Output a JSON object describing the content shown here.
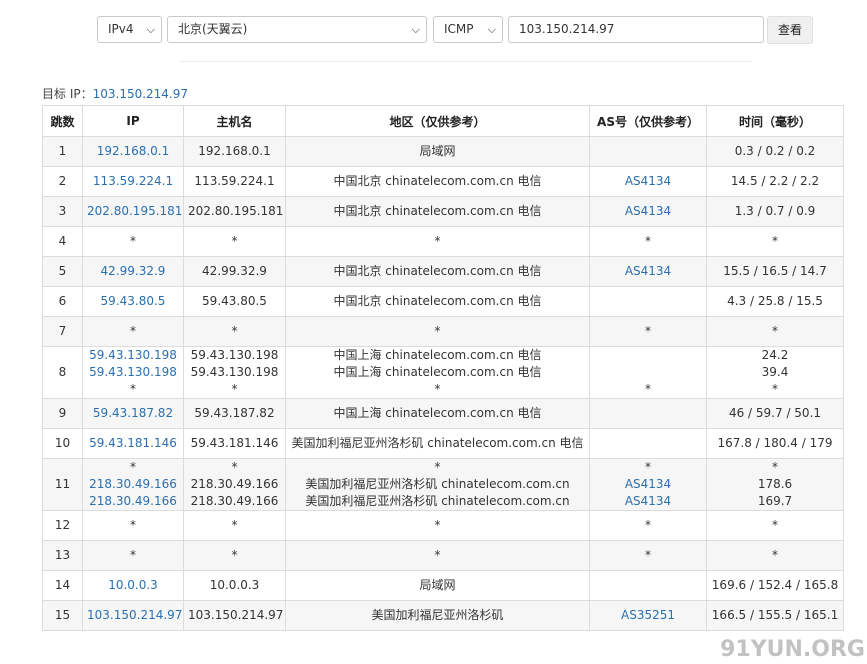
{
  "controls": {
    "ip_version": "IPv4",
    "node": "北京(天翼云)",
    "protocol": "ICMP",
    "target_input": "103.150.214.97",
    "submit_label": "查看"
  },
  "target": {
    "label": "目标 IP：",
    "value": "103.150.214.97"
  },
  "table": {
    "headers": [
      "跳数",
      "IP",
      "主机名",
      "地区（仅供参考）",
      "AS号（仅供参考）",
      "时间（毫秒）"
    ],
    "rows": [
      {
        "hop": "1",
        "ip": [
          "192.168.0.1"
        ],
        "host": [
          "192.168.0.1"
        ],
        "region": [
          "局域网"
        ],
        "asn": [
          ""
        ],
        "time": [
          "0.3 / 0.2 / 0.2"
        ]
      },
      {
        "hop": "2",
        "ip": [
          "113.59.224.1"
        ],
        "host": [
          "113.59.224.1"
        ],
        "region": [
          "中国北京 chinatelecom.com.cn 电信"
        ],
        "asn": [
          "AS4134"
        ],
        "time": [
          "14.5 / 2.2 / 2.2"
        ]
      },
      {
        "hop": "3",
        "ip": [
          "202.80.195.181"
        ],
        "host": [
          "202.80.195.181"
        ],
        "region": [
          "中国北京 chinatelecom.com.cn 电信"
        ],
        "asn": [
          "AS4134"
        ],
        "time": [
          "1.3 / 0.7 / 0.9"
        ]
      },
      {
        "hop": "4",
        "ip": [
          "*"
        ],
        "host": [
          "*"
        ],
        "region": [
          "*"
        ],
        "asn": [
          "*"
        ],
        "time": [
          "*"
        ]
      },
      {
        "hop": "5",
        "ip": [
          "42.99.32.9"
        ],
        "host": [
          "42.99.32.9"
        ],
        "region": [
          "中国北京 chinatelecom.com.cn 电信"
        ],
        "asn": [
          "AS4134"
        ],
        "time": [
          "15.5 / 16.5 / 14.7"
        ]
      },
      {
        "hop": "6",
        "ip": [
          "59.43.80.5"
        ],
        "host": [
          "59.43.80.5"
        ],
        "region": [
          "中国北京 chinatelecom.com.cn 电信"
        ],
        "asn": [
          ""
        ],
        "time": [
          "4.3 / 25.8 / 15.5"
        ]
      },
      {
        "hop": "7",
        "ip": [
          "*"
        ],
        "host": [
          "*"
        ],
        "region": [
          "*"
        ],
        "asn": [
          "*"
        ],
        "time": [
          "*"
        ]
      },
      {
        "hop": "8",
        "ip": [
          "59.43.130.198",
          "59.43.130.198",
          "*"
        ],
        "host": [
          "59.43.130.198",
          "59.43.130.198",
          "*"
        ],
        "region": [
          "中国上海 chinatelecom.com.cn 电信",
          "中国上海 chinatelecom.com.cn 电信",
          "*"
        ],
        "asn": [
          "",
          "",
          "*"
        ],
        "time": [
          "24.2",
          "39.4",
          "*"
        ]
      },
      {
        "hop": "9",
        "ip": [
          "59.43.187.82"
        ],
        "host": [
          "59.43.187.82"
        ],
        "region": [
          "中国上海 chinatelecom.com.cn 电信"
        ],
        "asn": [
          ""
        ],
        "time": [
          "46 / 59.7 / 50.1"
        ]
      },
      {
        "hop": "10",
        "ip": [
          "59.43.181.146"
        ],
        "host": [
          "59.43.181.146"
        ],
        "region": [
          "美国加利福尼亚州洛杉矶 chinatelecom.com.cn 电信"
        ],
        "asn": [
          ""
        ],
        "time": [
          "167.8 / 180.4 / 179"
        ]
      },
      {
        "hop": "11",
        "ip": [
          "*",
          "218.30.49.166",
          "218.30.49.166"
        ],
        "host": [
          "*",
          "218.30.49.166",
          "218.30.49.166"
        ],
        "region": [
          "*",
          "美国加利福尼亚州洛杉矶 chinatelecom.com.cn",
          "美国加利福尼亚州洛杉矶 chinatelecom.com.cn"
        ],
        "asn": [
          "*",
          "AS4134",
          "AS4134"
        ],
        "time": [
          "*",
          "178.6",
          "169.7"
        ]
      },
      {
        "hop": "12",
        "ip": [
          "*"
        ],
        "host": [
          "*"
        ],
        "region": [
          "*"
        ],
        "asn": [
          "*"
        ],
        "time": [
          "*"
        ]
      },
      {
        "hop": "13",
        "ip": [
          "*"
        ],
        "host": [
          "*"
        ],
        "region": [
          "*"
        ],
        "asn": [
          "*"
        ],
        "time": [
          "*"
        ]
      },
      {
        "hop": "14",
        "ip": [
          "10.0.0.3"
        ],
        "host": [
          "10.0.0.3"
        ],
        "region": [
          "局域网"
        ],
        "asn": [
          ""
        ],
        "time": [
          "169.6 / 152.4 / 165.8"
        ]
      },
      {
        "hop": "15",
        "ip": [
          "103.150.214.97"
        ],
        "host": [
          "103.150.214.97"
        ],
        "region": [
          "美国加利福尼亚州洛杉矶"
        ],
        "asn": [
          "AS35251"
        ],
        "time": [
          "166.5 / 155.5 / 165.1"
        ]
      }
    ]
  },
  "watermark": "91YUN.ORG"
}
